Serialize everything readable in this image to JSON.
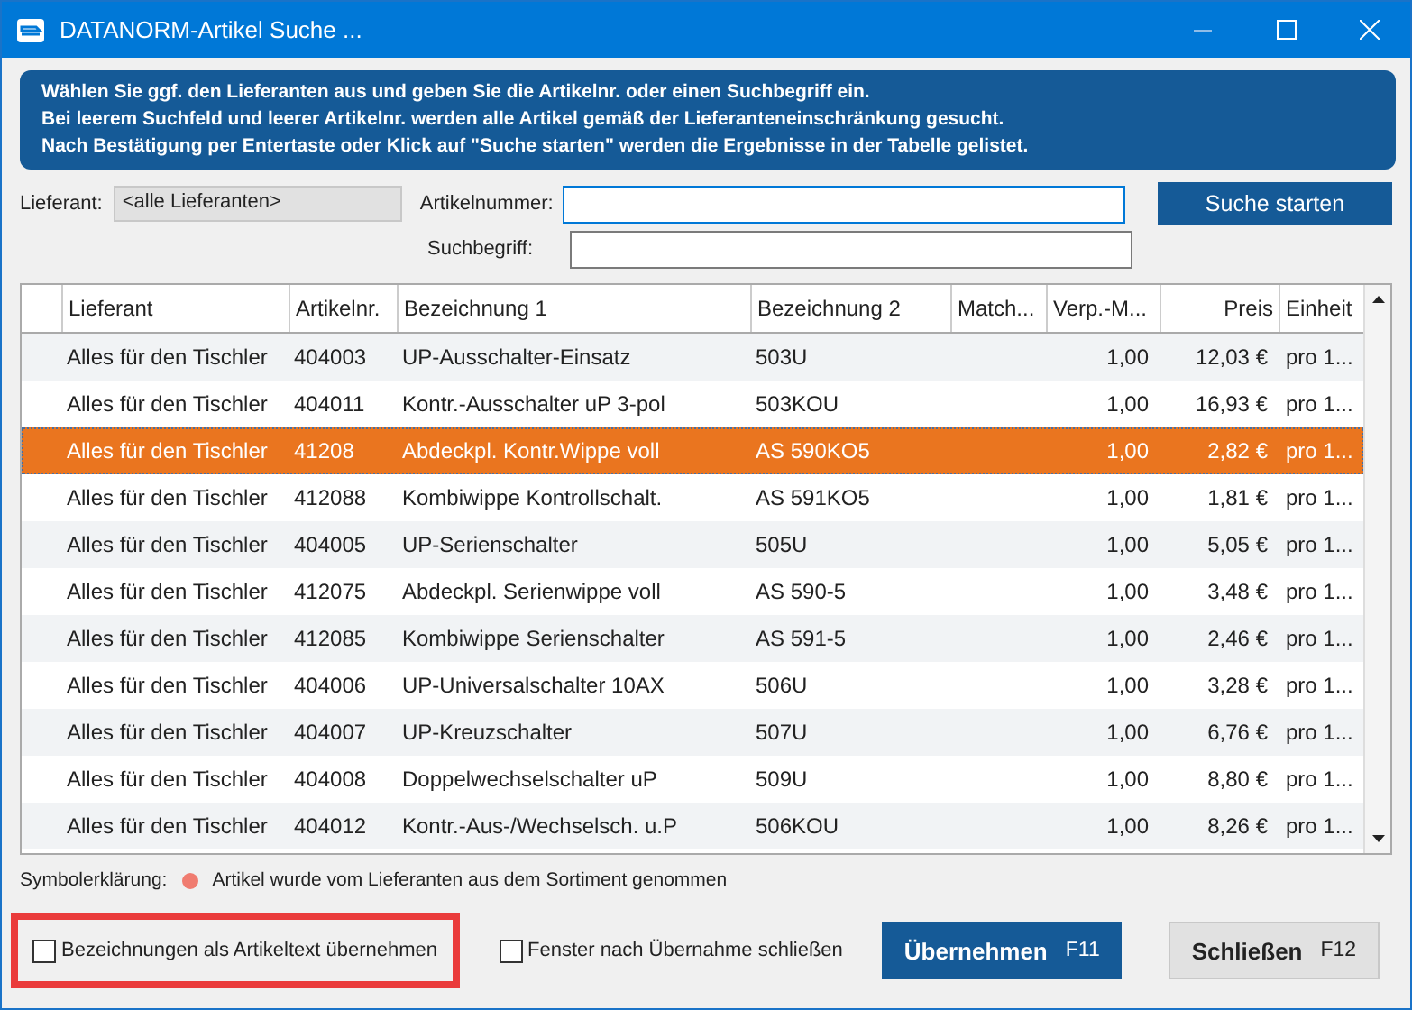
{
  "window": {
    "title": "DATANORM-Artikel Suche ..."
  },
  "info_lines": [
    "Wählen Sie ggf. den Lieferanten aus und geben Sie die Artikelnr. oder einen Suchbegriff ein.",
    "Bei leerem Suchfeld und leerer Artikelnr. werden alle Artikel gemäß der Lieferanteneinschränkung gesucht.",
    "Nach Bestätigung per Entertaste oder Klick auf \"Suche starten\" werden die Ergebnisse in der Tabelle gelistet."
  ],
  "filters": {
    "supplier_label": "Lieferant:",
    "supplier_value": "<alle Lieferanten>",
    "article_label": "Artikelnummer:",
    "search_label": "Suchbegriff:",
    "search_button": "Suche starten"
  },
  "table": {
    "columns": [
      "Lieferant",
      "Artikelnr.",
      "Bezeichnung 1",
      "Bezeichnung 2",
      "Match...",
      "Verp.-M...",
      "Preis",
      "Einheit"
    ],
    "rows": [
      {
        "cells": [
          "Alles für den Tischler",
          "404003",
          "UP-Ausschalter-Einsatz",
          "503U",
          "",
          "1,00",
          "12,03 €",
          "pro 1..."
        ],
        "selected": false
      },
      {
        "cells": [
          "Alles für den Tischler",
          "404011",
          "Kontr.-Ausschalter uP 3-pol",
          "503KOU",
          "",
          "1,00",
          "16,93 €",
          "pro 1..."
        ],
        "selected": false
      },
      {
        "cells": [
          "Alles für den Tischler",
          "41208",
          "Abdeckpl. Kontr.Wippe voll",
          "AS 590KO5",
          "",
          "1,00",
          "2,82 €",
          "pro 1..."
        ],
        "selected": true
      },
      {
        "cells": [
          "Alles für den Tischler",
          "412088",
          "Kombiwippe Kontrollschalt.",
          "AS 591KO5",
          "",
          "1,00",
          "1,81 €",
          "pro 1..."
        ],
        "selected": false
      },
      {
        "cells": [
          "Alles für den Tischler",
          "404005",
          "UP-Serienschalter",
          "505U",
          "",
          "1,00",
          "5,05 €",
          "pro 1..."
        ],
        "selected": false
      },
      {
        "cells": [
          "Alles für den Tischler",
          "412075",
          "Abdeckpl. Serienwippe voll",
          "AS 590-5",
          "",
          "1,00",
          "3,48 €",
          "pro 1..."
        ],
        "selected": false
      },
      {
        "cells": [
          "Alles für den Tischler",
          "412085",
          "Kombiwippe Serienschalter",
          "AS 591-5",
          "",
          "1,00",
          "2,46 €",
          "pro 1..."
        ],
        "selected": false
      },
      {
        "cells": [
          "Alles für den Tischler",
          "404006",
          "UP-Universalschalter 10AX",
          "506U",
          "",
          "1,00",
          "3,28 €",
          "pro 1..."
        ],
        "selected": false
      },
      {
        "cells": [
          "Alles für den Tischler",
          "404007",
          "UP-Kreuzschalter",
          "507U",
          "",
          "1,00",
          "6,76 €",
          "pro 1..."
        ],
        "selected": false
      },
      {
        "cells": [
          "Alles für den Tischler",
          "404008",
          "Doppelwechselschalter uP",
          "509U",
          "",
          "1,00",
          "8,80 €",
          "pro 1..."
        ],
        "selected": false
      },
      {
        "cells": [
          "Alles für den Tischler",
          "404012",
          "Kontr.-Aus-/Wechselsch. u.P",
          "506KOU",
          "",
          "1,00",
          "8,26 €",
          "pro 1..."
        ],
        "selected": false
      }
    ]
  },
  "legend": {
    "label": "Symbolerklärung:",
    "color": "#f07c70",
    "text": "Artikel wurde vom Lieferanten aus dem Sortiment genommen"
  },
  "options": [
    {
      "label": "Bezeichnungen als Artikeltext übernehmen",
      "checked": false,
      "highlighted": true
    },
    {
      "label": "Fenster nach Übernahme schließen",
      "checked": false,
      "highlighted": false
    }
  ],
  "buttons": [
    {
      "label": "Übernehmen",
      "shortcut": "F11",
      "kind": "primary"
    },
    {
      "label": "Schließen",
      "shortcut": "F12",
      "kind": "secondary"
    }
  ]
}
